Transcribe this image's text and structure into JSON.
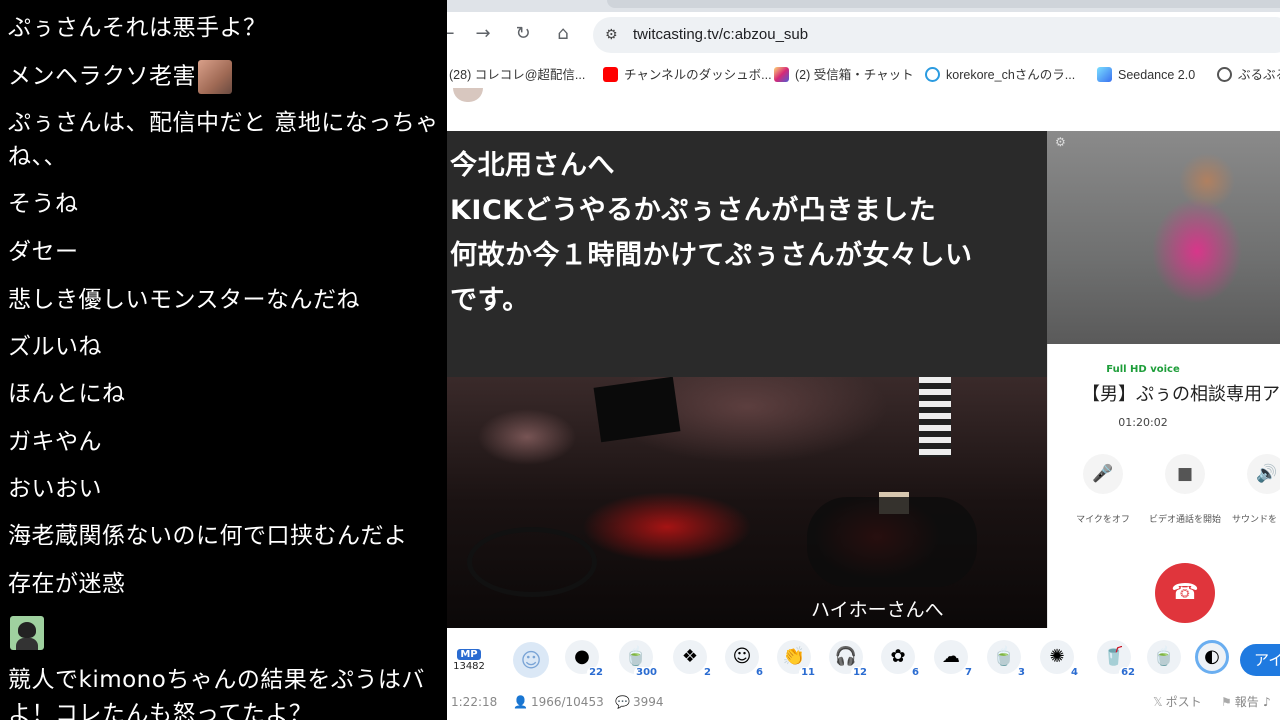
{
  "comments": [
    "ぷぅさんそれは悪手よ？",
    "メンヘラクソ老害",
    "ぷぅさんは、配信中だと 意地になっちゃ",
    "ね、、",
    "そうね",
    "ダセー",
    "悲しき優しいモンスターなんだね",
    "ズルいね",
    "ほんとにね",
    "ガキやん",
    "おいおい",
    "海老蔵関係ないのに何で口挟むんだよ",
    "存在が迷惑",
    "競人でkimonoちゃんの結果をぷうはバ",
    "よ！コレたんも怒ってたよ？"
  ],
  "browser": {
    "url": "twitcasting.tv/c:abzou_sub",
    "bookmarks": [
      {
        "label": "(28) コレコレ@超配信...",
        "icon": "red-folder-icon",
        "color": "#c62828"
      },
      {
        "label": "チャンネルのダッシュボ...",
        "icon": "youtube-icon",
        "color": "#ff0000"
      },
      {
        "label": "(2) 受信箱・チャット",
        "icon": "instagram-icon",
        "color": "#d62976"
      },
      {
        "label": "korekore_chさんのラ...",
        "icon": "headphones-icon",
        "color": "#2b9be0"
      },
      {
        "label": "Seedance 2.0",
        "icon": "seedance-icon",
        "color": "#3aa0f0"
      },
      {
        "label": "ぶるぶる",
        "icon": "globe-icon",
        "color": "#555555"
      }
    ]
  },
  "stream": {
    "caption": "今北用さんへ\nKICKどうやるかぷぅさんが凸きました\n何故か今１時間かけてぷぅさんが女々しい\nです。",
    "subtitle": "ハイホーさんへ"
  },
  "call": {
    "hd_label": "Full HD voice",
    "title": "【男】ぷぅの相談専用アカ",
    "time": "01:20:02",
    "buttons": [
      {
        "label": "マイクをオフ",
        "icon": "microphone-icon",
        "glyph": "🎤"
      },
      {
        "label": "ビデオ通話を開始",
        "icon": "video-camera-icon",
        "glyph": "■"
      },
      {
        "label": "サウンドを",
        "icon": "speaker-icon",
        "glyph": "🔊"
      }
    ]
  },
  "giftbar": {
    "mp_badge": "MP",
    "mp_value": "13482",
    "gifts": [
      {
        "count": "22",
        "glyph": "●"
      },
      {
        "count": "300",
        "glyph": "🍵"
      },
      {
        "count": "2",
        "glyph": "❖"
      },
      {
        "count": "6",
        "glyph": "☺"
      },
      {
        "count": "11",
        "glyph": "👏"
      },
      {
        "count": "12",
        "glyph": "🎧"
      },
      {
        "count": "6",
        "glyph": "✿"
      },
      {
        "count": "7",
        "glyph": "☁"
      },
      {
        "count": "3",
        "glyph": "🍵"
      },
      {
        "count": "4",
        "glyph": "✺"
      },
      {
        "count": "62",
        "glyph": "🥤"
      },
      {
        "count": "",
        "glyph": "🍵"
      },
      {
        "count": "",
        "glyph": "◐"
      }
    ],
    "air_label": "アイ"
  },
  "stats": {
    "elapsed": "1:22:18",
    "viewers": "1966/10453",
    "comments": "3994",
    "post": "ポスト",
    "report": "報告"
  }
}
